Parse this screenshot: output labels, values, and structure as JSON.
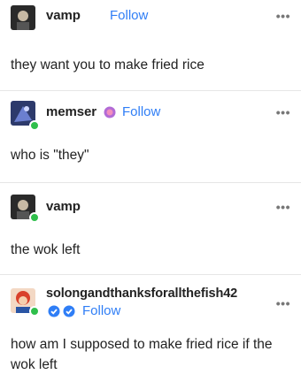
{
  "posts": [
    {
      "username": "vamp",
      "follow": "Follow",
      "body": "they want you to make fried rice",
      "more": "•••"
    },
    {
      "username": "memser",
      "follow": "Follow",
      "body": "who is \"they\"",
      "more": "•••"
    },
    {
      "username": "vamp",
      "body": "the wok left",
      "more": "•••"
    },
    {
      "username": "solongandthanksforallthefish42",
      "follow": "Follow",
      "body": "how am I supposed to make fried rice if the wok left",
      "more": "•••"
    }
  ],
  "colors": {
    "follow": "#2f7ef6",
    "badge_green": "#2fbf4b",
    "verified": "#2f7ef6"
  },
  "icons": [
    "avatar-image",
    "more-options-icon",
    "verified-icon",
    "pride-badge-icon"
  ]
}
